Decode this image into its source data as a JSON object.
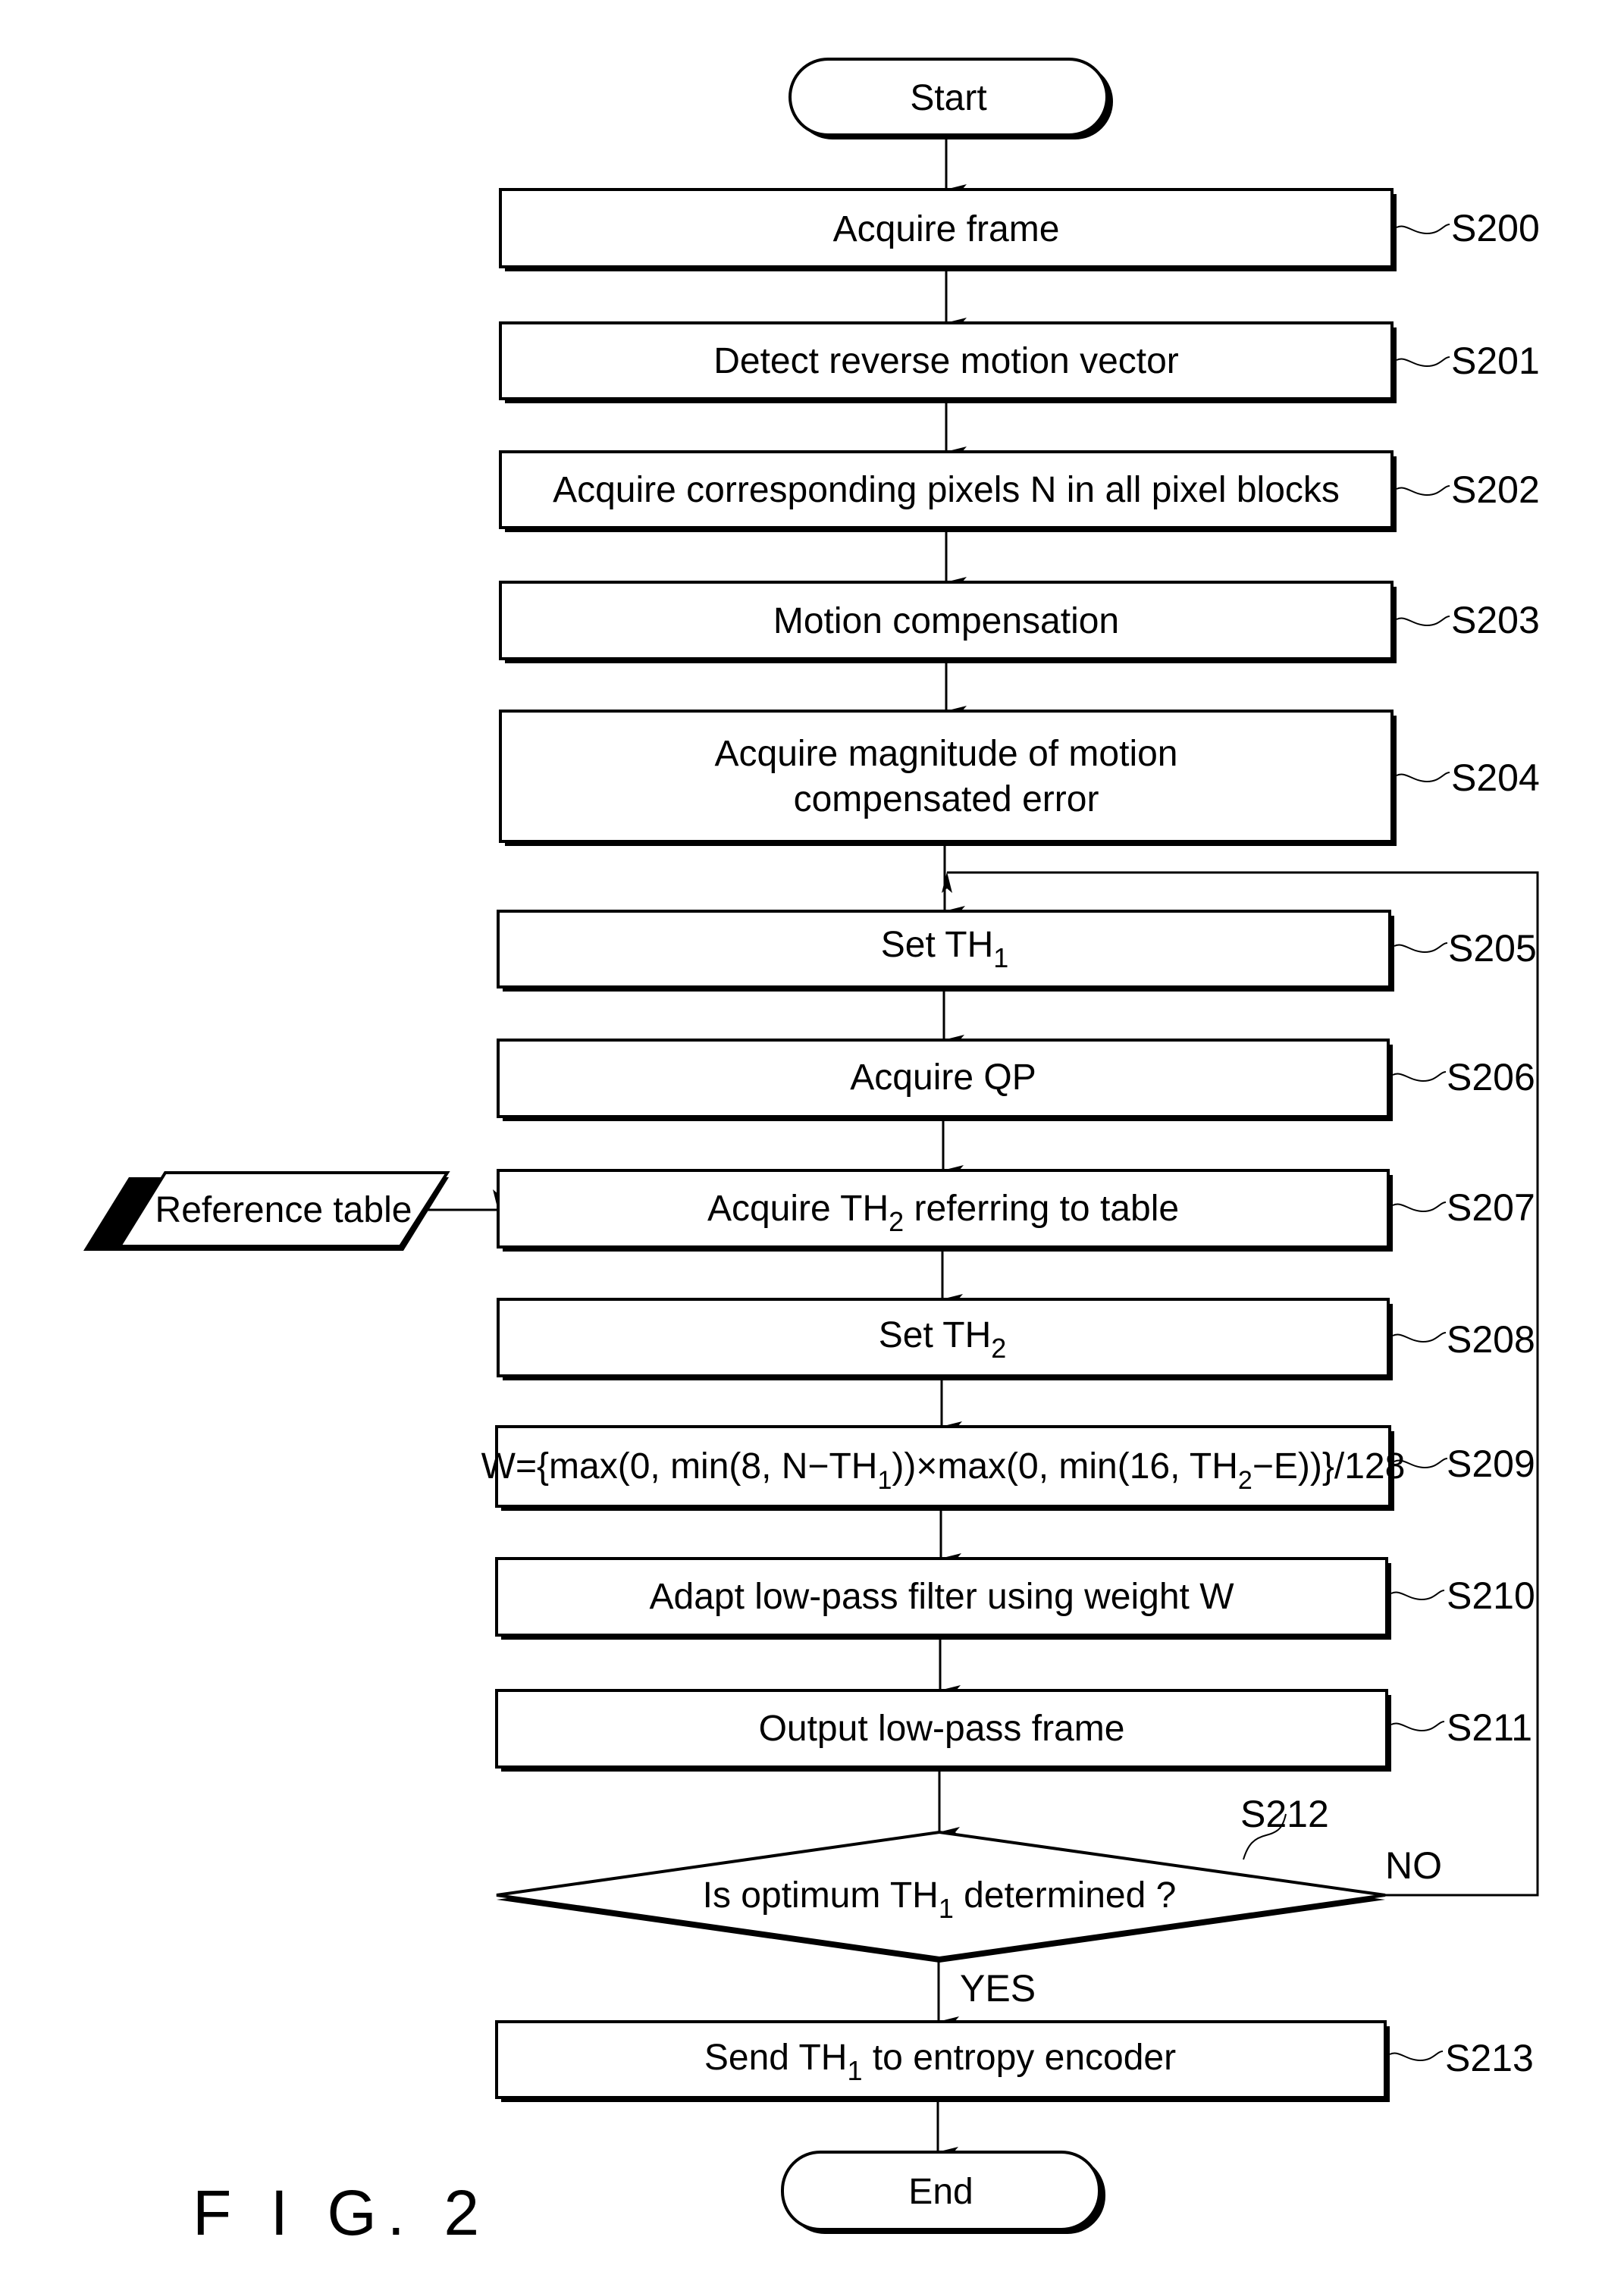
{
  "figure": {
    "caption": "F I G. 2",
    "type": "flowchart"
  },
  "terminals": {
    "start": "Start",
    "end": "End"
  },
  "steps": [
    {
      "id": "S200",
      "text": "Acquire frame"
    },
    {
      "id": "S201",
      "text": "Detect reverse motion vector"
    },
    {
      "id": "S202",
      "text": "Acquire corresponding pixels N in all pixel blocks"
    },
    {
      "id": "S203",
      "text": "Motion compensation"
    },
    {
      "id": "S204",
      "text_line1": "Acquire magnitude of motion",
      "text_line2": "compensated error"
    },
    {
      "id": "S205",
      "text": "Set TH",
      "sub": "1"
    },
    {
      "id": "S206",
      "text": "Acquire QP"
    },
    {
      "id": "S207",
      "text": "Acquire TH",
      "sub": "2",
      "text_after": " referring to table"
    },
    {
      "id": "S208",
      "text": "Set TH",
      "sub": "2"
    },
    {
      "id": "S209",
      "formula_parts": [
        "W={max(0, min(8, N−TH",
        "1",
        "))×max(0, min(16, TH",
        "2",
        "−E))}/128"
      ]
    },
    {
      "id": "S210",
      "text": "Adapt low-pass filter using weight W"
    },
    {
      "id": "S211",
      "text": "Output low-pass frame"
    },
    {
      "id": "S213",
      "text": "Send TH",
      "sub": "1",
      "text_after": " to entropy encoder"
    }
  ],
  "decision": {
    "id": "S212",
    "text": "Is optimum TH",
    "sub": "1",
    "text_after": " determined ?",
    "yes_label": "YES",
    "no_label": "NO"
  },
  "input": {
    "text": "Reference table"
  }
}
